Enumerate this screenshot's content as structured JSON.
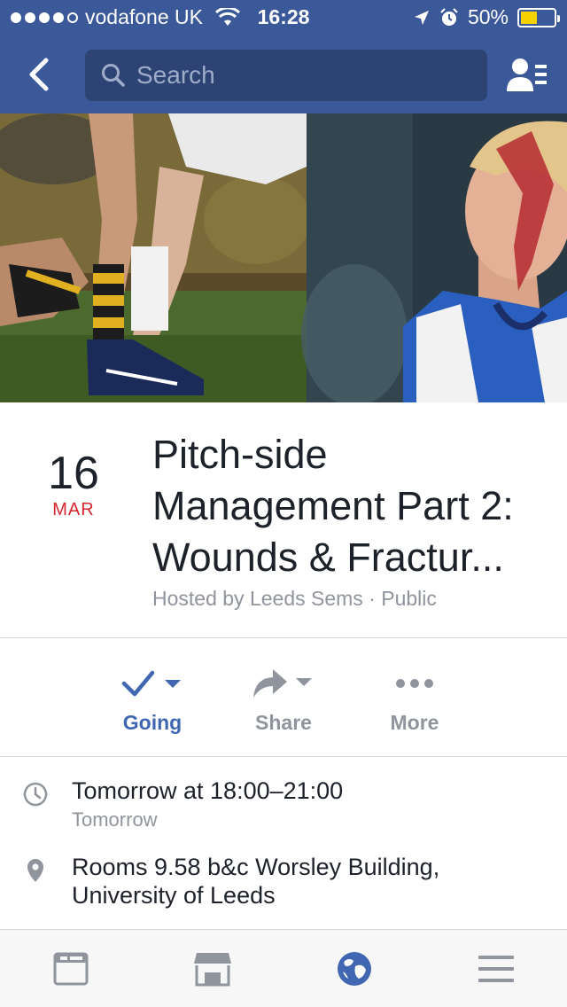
{
  "status_bar": {
    "carrier": "vodafone UK",
    "time": "16:28",
    "battery": "50%",
    "battery_level": 0.5,
    "signal_bars": 4
  },
  "nav": {
    "search_placeholder": "Search",
    "back_icon": "chevron-left-icon",
    "friends_icon": "friend-requests-icon"
  },
  "cover": {
    "description_left": "rugby-legs-photo",
    "description_right": "rugby-player-photo"
  },
  "event": {
    "day": "16",
    "month": "MAR",
    "title": "Pitch-side Management Part 2: Wounds & Fractur...",
    "subtitle": "Hosted by Leeds Sems · Public"
  },
  "actions": {
    "going_label": "Going",
    "share_label": "Share",
    "more_label": "More"
  },
  "details": {
    "time_main": "Tomorrow at 18:00–21:00",
    "time_sub": "Tomorrow",
    "place_main": "Rooms 9.58 b&c Worsley Building, University of Leeds"
  },
  "tabbar": {
    "items": [
      "news-feed-icon",
      "marketplace-icon",
      "notifications-globe-icon",
      "menu-icon"
    ]
  },
  "colors": {
    "brand": "#3b5998",
    "accent": "#4267b2",
    "date_red": "#d8262e",
    "muted": "#90949c"
  }
}
